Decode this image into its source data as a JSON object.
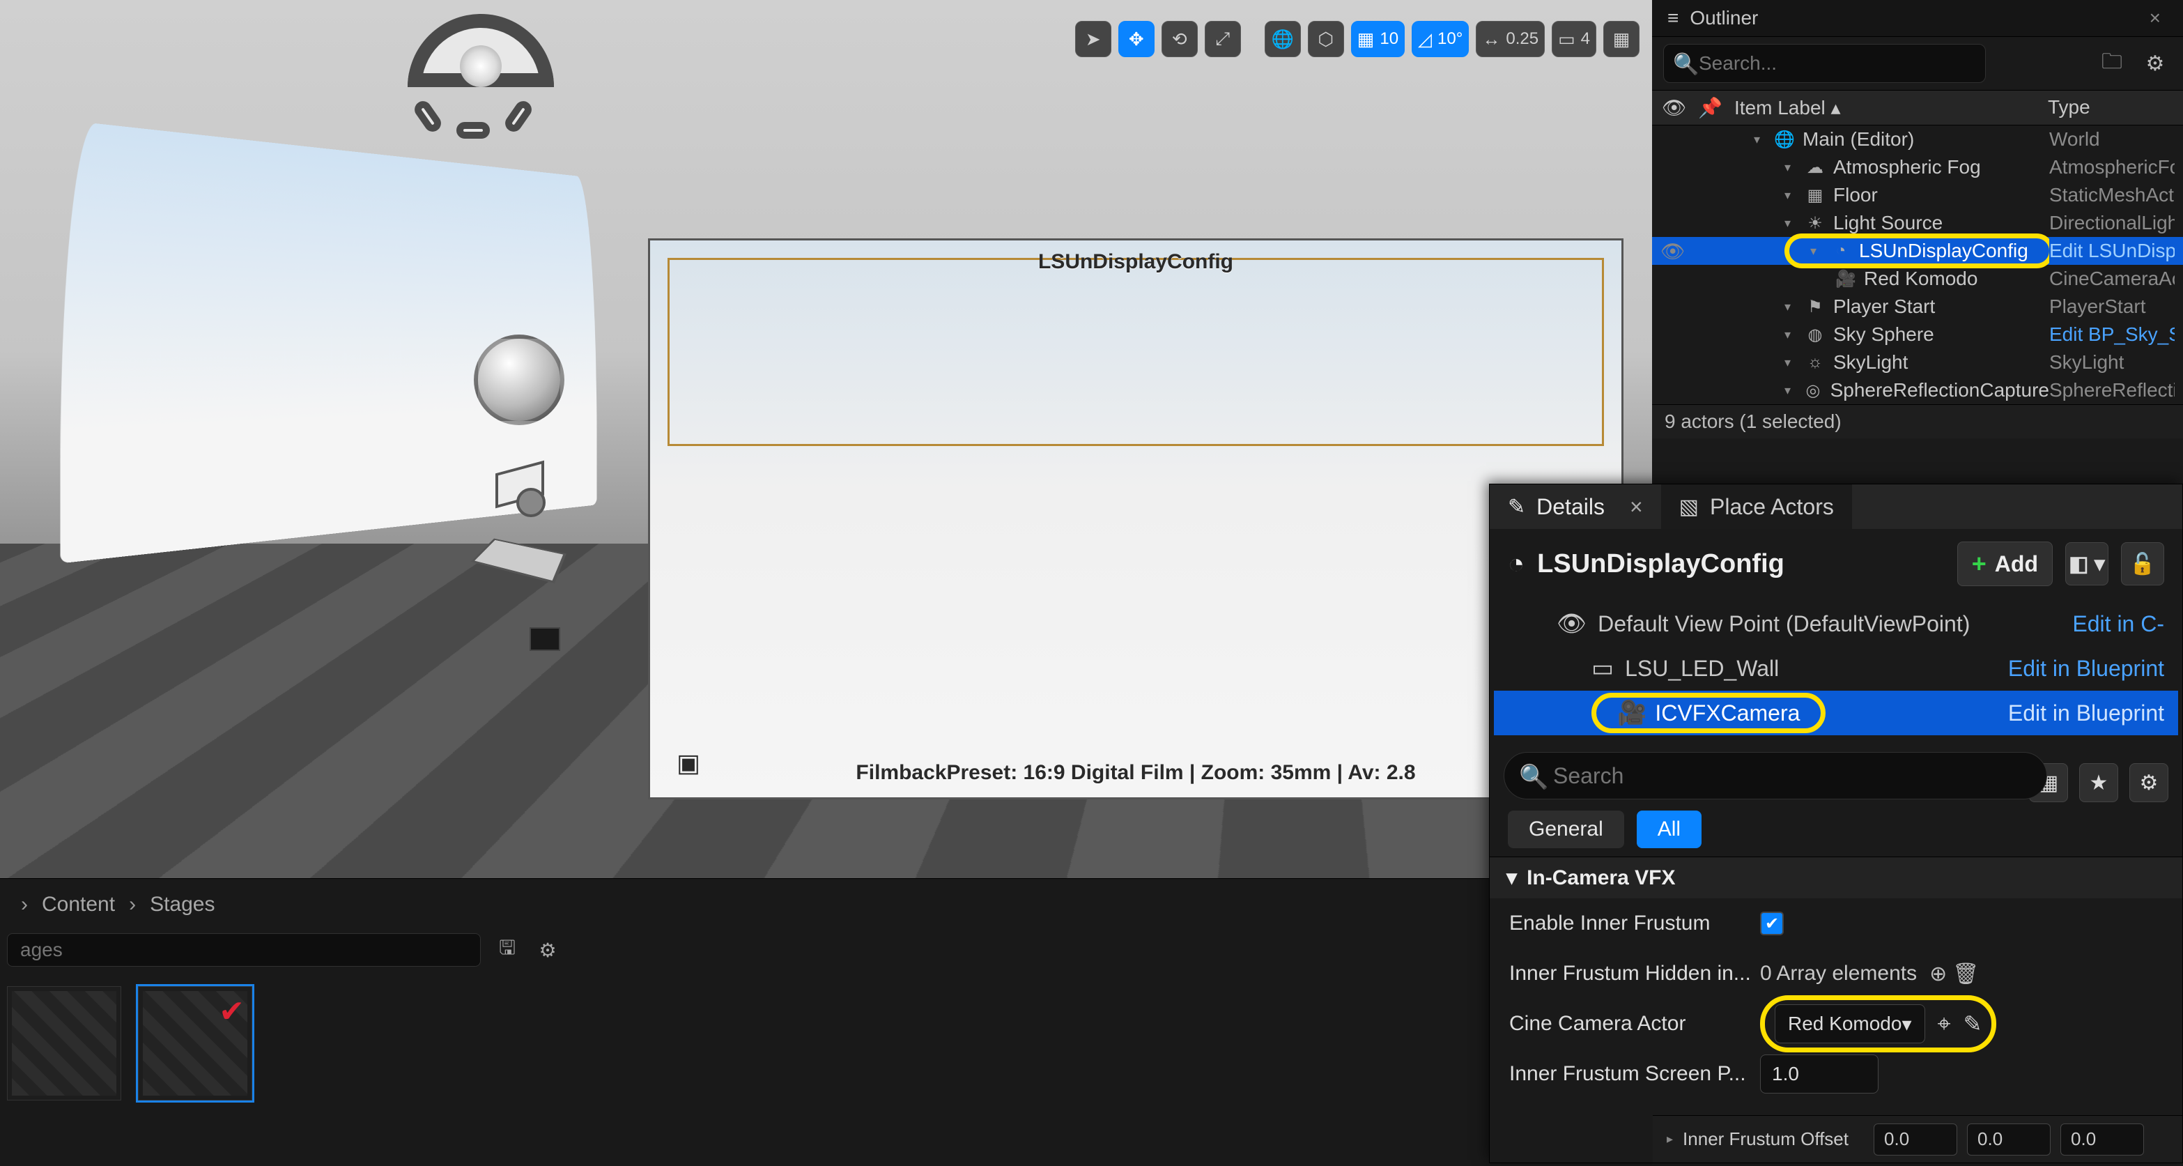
{
  "viewport": {
    "cam_label": "LSUnDisplayConfig",
    "cam_footer": "FilmbackPreset: 16:9 Digital Film | Zoom: 35mm | Av: 2.8",
    "toolbar": {
      "grid_value": "10",
      "angle_value": "10°",
      "scale_value": "0.25",
      "camera_value": "4"
    }
  },
  "content_browser": {
    "crumb1": "Content",
    "crumb2": "Stages",
    "search_placeholder": "ages"
  },
  "outliner": {
    "title": "Outliner",
    "search_placeholder": "Search...",
    "col_item": "Item Label",
    "col_type": "Type",
    "rows": [
      {
        "label": "Main (Editor)",
        "type": "World",
        "indent": 0,
        "icon": "world"
      },
      {
        "label": "Atmospheric Fog",
        "type": "AtmosphericFo",
        "indent": 1,
        "icon": "cloud"
      },
      {
        "label": "Floor",
        "type": "StaticMeshAct",
        "indent": 1,
        "icon": "mesh"
      },
      {
        "label": "Light Source",
        "type": "DirectionalLigh",
        "indent": 1,
        "icon": "sun"
      },
      {
        "label": "LSUnDisplayConfig",
        "type": "Edit LSUnDisp",
        "indent": 1,
        "icon": "ndisplay",
        "selected": true,
        "highlight": true,
        "typelink": true
      },
      {
        "label": "Red Komodo",
        "type": "CineCameraAc",
        "indent": 2,
        "icon": "cam"
      },
      {
        "label": "Player Start",
        "type": "PlayerStart",
        "indent": 1,
        "icon": "flag"
      },
      {
        "label": "Sky Sphere",
        "type": "Edit BP_Sky_S",
        "indent": 1,
        "icon": "sphere",
        "typelink": true
      },
      {
        "label": "SkyLight",
        "type": "SkyLight",
        "indent": 1,
        "icon": "skylight"
      },
      {
        "label": "SphereReflectionCapture",
        "type": "SphereReflecti",
        "indent": 1,
        "icon": "reflect"
      }
    ],
    "status": "9 actors (1 selected)"
  },
  "details": {
    "tab_details": "Details",
    "tab_place": "Place Actors",
    "actor_name": "LSUnDisplayConfig",
    "add_label": "Add",
    "components": [
      {
        "name": "Default View Point (DefaultViewPoint)",
        "action": "Edit in C-",
        "indent": 0,
        "icon": "view"
      },
      {
        "name": "LSU_LED_Wall",
        "action": "Edit in Blueprint",
        "indent": 1,
        "icon": "wall"
      },
      {
        "name": "ICVFXCamera",
        "action": "Edit in Blueprint",
        "indent": 1,
        "icon": "cam",
        "selected": true,
        "highlight": true
      }
    ],
    "search_placeholder": "Search",
    "filter_general": "General",
    "filter_all": "All",
    "section": "In-Camera VFX",
    "props": {
      "enable_label": "Enable Inner Frustum",
      "hidden_label": "Inner Frustum Hidden in...",
      "hidden_value": "0 Array elements",
      "cine_label": "Cine Camera Actor",
      "cine_value": "Red Komodo",
      "screen_label": "Inner Frustum Screen P...",
      "screen_value": "1.0"
    },
    "frustum_offset": {
      "label": "Inner Frustum Offset",
      "x": "0.0",
      "y": "0.0",
      "z": "0.0"
    }
  }
}
